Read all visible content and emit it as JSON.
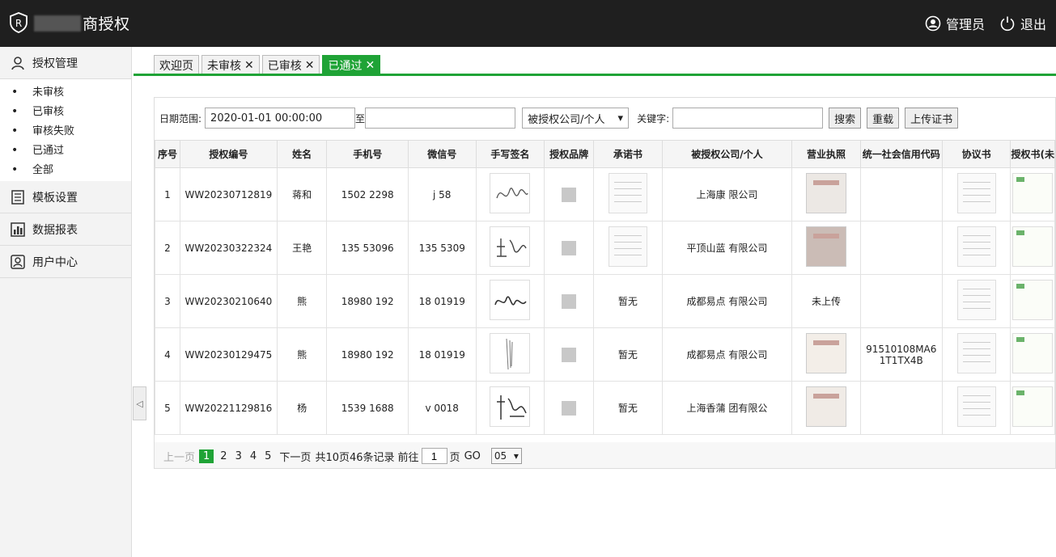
{
  "app": {
    "title": "商授权",
    "user": "管理员",
    "logout": "退出"
  },
  "sidebar": {
    "auth": "授权管理",
    "sub": [
      "未审核",
      "已审核",
      "审核失败",
      "已通过",
      "全部"
    ],
    "template": "模板设置",
    "report": "数据报表",
    "user": "用户中心"
  },
  "tabs": [
    {
      "label": "欢迎页"
    },
    {
      "label": "未审核"
    },
    {
      "label": "已审核"
    },
    {
      "label": "已通过"
    }
  ],
  "filter": {
    "date_label": "日期范围:",
    "date_from": "2020-01-01 00:00:00",
    "to": "至",
    "date_to": "",
    "select": "被授权公司/个人",
    "keyword_label": "关键字:",
    "keyword": "",
    "search": "搜索",
    "reset": "重载",
    "upload": "上传证书"
  },
  "table": {
    "headers": [
      "序号",
      "授权编号",
      "姓名",
      "手机号",
      "微信号",
      "手写签名",
      "授权品牌",
      "承诺书",
      "被授权公司/个人",
      "营业执照",
      "统一社会信用代码",
      "协议书",
      "授权书(未"
    ],
    "rows": [
      {
        "no": "1",
        "code": "WW20230712819",
        "name": "蒋和",
        "phone": "1502   2298",
        "wechat": "j   58",
        "commit": "",
        "company": "上海康            限公司",
        "license_text": "",
        "credit": ""
      },
      {
        "no": "2",
        "code": "WW20230322324",
        "name": "王艳",
        "phone": "135   53096",
        "wechat": "135   5309",
        "commit": "",
        "company": "平顶山蓝           有限公司",
        "license_text": "",
        "credit": ""
      },
      {
        "no": "3",
        "code": "WW20230210640",
        "name": "熊",
        "phone": "18980   192",
        "wechat": "18   01919",
        "commit": "暂无",
        "company": "成都易点         有限公司",
        "license_text": "未上传",
        "credit": ""
      },
      {
        "no": "4",
        "code": "WW20230129475",
        "name": "熊",
        "phone": "18980   192",
        "wechat": "18   01919",
        "commit": "暂无",
        "company": "成都易点         有限公司",
        "license_text": "",
        "credit": "91510108MA61T1TX4B"
      },
      {
        "no": "5",
        "code": "WW20221129816",
        "name": "杨",
        "phone": "1539   1688",
        "wechat": "v   0018",
        "commit": "暂无",
        "company": "上海香蒲         团有限公",
        "license_text": "",
        "credit": ""
      }
    ]
  },
  "pager": {
    "prev": "上一页",
    "pages": [
      "1",
      "2",
      "3",
      "4",
      "5"
    ],
    "next": "下一页",
    "summary": "共10页46条记录",
    "goto": "前往",
    "page_input": "1",
    "page_unit": "页",
    "go": "GO",
    "size": "05"
  }
}
